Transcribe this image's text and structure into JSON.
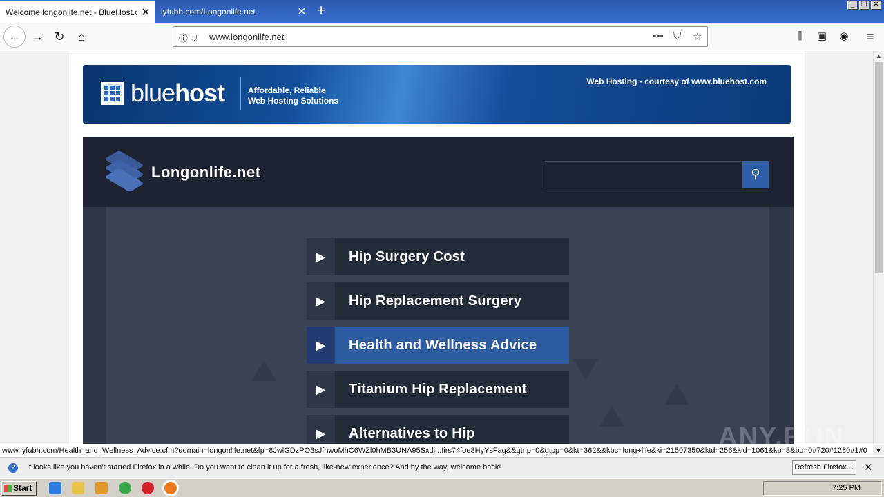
{
  "browser": {
    "tabs": [
      {
        "label": "Welcome longonlife.net - BlueHost.com",
        "active": true
      },
      {
        "label": "iyfubh.com/Longonlife.net",
        "active": false
      }
    ],
    "new_tab_glyph": "+",
    "url": "www.longonlife.net",
    "status_url": "www.iyfubh.com/Health_and_Wellness_Advice.cfm?domain=longonlife.net&fp=8JwlGDzPO3sJfnwoMhC6WZl0hMB3UNA95Sxdj...Iirs74foe3HyYsFag&&gtnp=0&gtpp=0&kt=362&&kbc=long+life&ki=21507350&ktd=256&kld=1061&kp=3&bd=0#720#1280#1#0"
  },
  "banner": {
    "brand_light": "blue",
    "brand_bold": "host",
    "tagline_1": "Affordable, Reliable",
    "tagline_2": "Web Hosting Solutions",
    "courtesy": "Web Hosting - courtesy of www.bluehost.com"
  },
  "site": {
    "name": "Longonlife.net",
    "search_placeholder": "",
    "menu": [
      {
        "label": "Hip Surgery Cost",
        "active": false
      },
      {
        "label": "Hip Replacement Surgery",
        "active": false
      },
      {
        "label": "Health and Wellness Advice",
        "active": true
      },
      {
        "label": "Titanium Hip Replacement",
        "active": false
      },
      {
        "label": "Alternatives to Hip",
        "active": false
      }
    ]
  },
  "notification": {
    "message": "It looks like you haven’t started Firefox in a while. Do you want to clean it up for a fresh, like-new experience? And by the way, welcome back!",
    "button": "Refresh Firefox…"
  },
  "taskbar": {
    "start": "Start",
    "clock": "7:25 PM"
  },
  "watermark": "ANY.RUN",
  "colors": {
    "accent": "#2c5ba0",
    "header": "#1d2330"
  }
}
